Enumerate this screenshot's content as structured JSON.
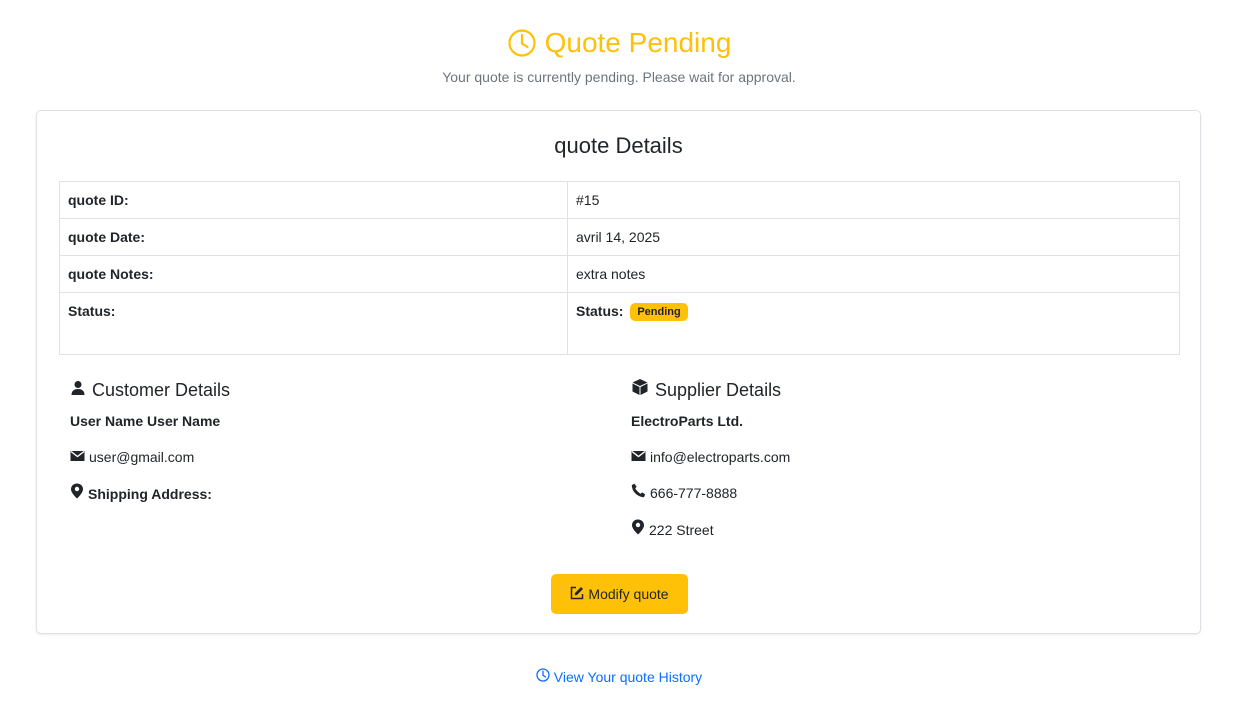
{
  "header": {
    "title": "Quote Pending",
    "subtitle": "Your quote is currently pending. Please wait for approval.",
    "icon": "clock-icon",
    "accent_color": "#ffc107"
  },
  "details": {
    "title": "quote Details",
    "rows": [
      {
        "label": "quote ID:",
        "value": "#15"
      },
      {
        "label": "quote Date:",
        "value": "avril 14, 2025"
      },
      {
        "label": "quote Notes:",
        "value": "extra notes"
      }
    ],
    "status_label": "Status:",
    "status_value_label": "Status:",
    "status_badge": "Pending"
  },
  "customer": {
    "heading": "Customer Details",
    "icon": "user-icon",
    "name": "User Name User Name",
    "email": "user@gmail.com",
    "shipping_label": "Shipping Address:"
  },
  "supplier": {
    "heading": "Supplier Details",
    "icon": "box-icon",
    "name": "ElectroParts Ltd.",
    "email": "info@electroparts.com",
    "phone": "666-777-8888",
    "address": "222 Street"
  },
  "actions": {
    "modify_label": "Modify quote",
    "history_label": "View Your quote History"
  },
  "colors": {
    "warning": "#ffc107",
    "link": "#0d6efd",
    "muted": "#6c757d",
    "border": "#dee2e6"
  }
}
